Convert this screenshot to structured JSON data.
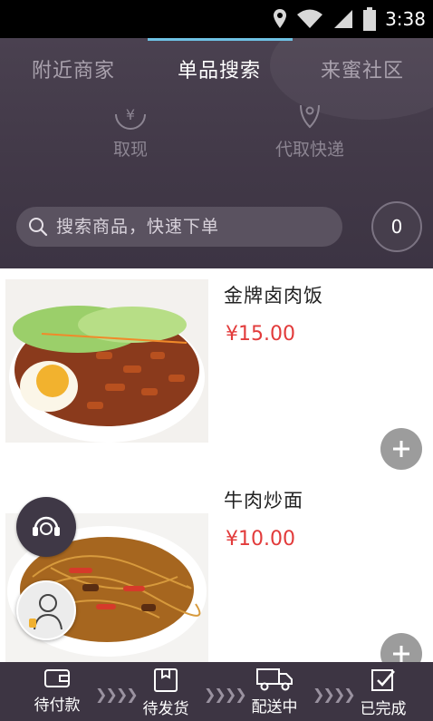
{
  "status_bar": {
    "time": "3:38",
    "icons": [
      "location-icon",
      "wifi-icon",
      "signal-icon",
      "battery-icon"
    ]
  },
  "tabs": [
    {
      "label": "附近商家",
      "active": false
    },
    {
      "label": "单品搜索",
      "active": true
    },
    {
      "label": "来蜜社区",
      "active": false
    }
  ],
  "quick_actions": [
    {
      "label": "取现",
      "icon": "yen-circle-icon"
    },
    {
      "label": "代取快递",
      "icon": "location-pin-icon"
    }
  ],
  "search": {
    "placeholder": "搜索商品，快速下单"
  },
  "cart": {
    "count": "0"
  },
  "products": [
    {
      "name": "金牌卤肉饭",
      "price": "¥15.00",
      "image": "braised-pork-rice-image"
    },
    {
      "name": "牛肉炒面",
      "price": "¥10.00",
      "image": "beef-fried-noodles-image"
    }
  ],
  "order_steps": [
    {
      "label": "待付款",
      "icon": "wallet-icon"
    },
    {
      "label": "待发货",
      "icon": "package-icon"
    },
    {
      "label": "配送中",
      "icon": "truck-icon"
    },
    {
      "label": "已完成",
      "icon": "check-box-icon"
    }
  ],
  "colors": {
    "header_bg": "#413847",
    "price": "#e23b3b",
    "tab_indicator": "#6ec1e4",
    "bottom_bar": "#3d3543"
  }
}
